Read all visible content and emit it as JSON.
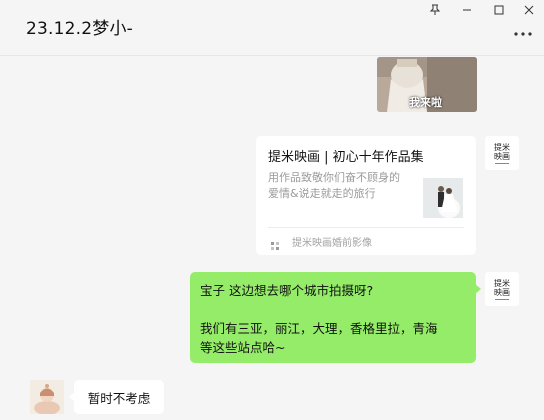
{
  "window": {
    "title": "23.12.2梦小-",
    "pin_icon": "pin-icon",
    "minimize_icon": "minimize-icon",
    "maximize_icon": "maximize-icon",
    "close_icon": "close-icon",
    "more_icon": "more-icon"
  },
  "messages": {
    "image_caption": "我来啦",
    "link_card": {
      "title": "提米映画 | 初心十年作品集",
      "description": "用作品致敬你们奋不顾身的爱情&说走就走的旅行",
      "source": "提米映画婚前影像"
    },
    "green_bubble": {
      "line1": "宝子   这边想去哪个城市拍摄呀?",
      "line2": "我们有三亚，丽江，大理，香格里拉，青海",
      "line3": "等这些站点哈~"
    },
    "reply": {
      "text": "暂时不考虑"
    },
    "brand_avatar": {
      "line1": "提米",
      "line2": "映画"
    }
  },
  "colors": {
    "background": "#f5f5f5",
    "bubble_green": "#95ec69",
    "bubble_white": "#ffffff"
  }
}
